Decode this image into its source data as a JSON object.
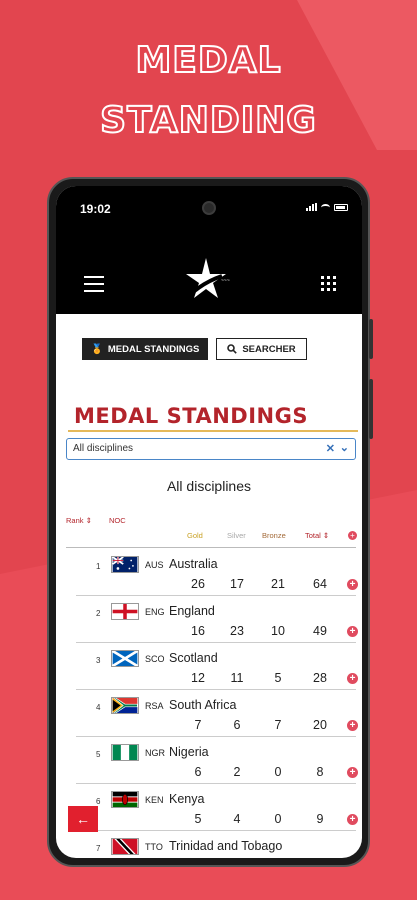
{
  "promo": {
    "line1": "MEDAL",
    "line2": "STANDING"
  },
  "status_bar": {
    "time": "19:02"
  },
  "nav": {
    "menu_icon": "hamburger-icon",
    "apps_icon": "grid-icon",
    "logo_icon": "star-logo"
  },
  "buttons": {
    "medal_standings": "MEDAL STANDINGS",
    "searcher": "SEARCHER"
  },
  "page": {
    "title": "MEDAL STANDINGS",
    "discipline_select_value": "All disciplines",
    "discipline_heading": "All disciplines"
  },
  "table": {
    "headers": {
      "rank": "Rank ⇕",
      "noc": "NOC",
      "gold": "Gold",
      "silver": "Silver",
      "bronze": "Bronze",
      "total": "Total ⇕"
    },
    "rows": [
      {
        "rank": "1",
        "code": "AUS",
        "country": "Australia",
        "gold": "26",
        "silver": "17",
        "bronze": "21",
        "total": "64"
      },
      {
        "rank": "2",
        "code": "ENG",
        "country": "England",
        "gold": "16",
        "silver": "23",
        "bronze": "10",
        "total": "49"
      },
      {
        "rank": "3",
        "code": "SCO",
        "country": "Scotland",
        "gold": "12",
        "silver": "11",
        "bronze": "5",
        "total": "28"
      },
      {
        "rank": "4",
        "code": "RSA",
        "country": "South Africa",
        "gold": "7",
        "silver": "6",
        "bronze": "7",
        "total": "20"
      },
      {
        "rank": "5",
        "code": "NGR",
        "country": "Nigeria",
        "gold": "6",
        "silver": "2",
        "bronze": "0",
        "total": "8"
      },
      {
        "rank": "6",
        "code": "KEN",
        "country": "Kenya",
        "gold": "5",
        "silver": "4",
        "bronze": "0",
        "total": "9"
      },
      {
        "rank": "7",
        "code": "TTO",
        "country": "Trinidad and Tobago"
      }
    ]
  },
  "colors": {
    "background": "#e2454f",
    "title_red": "#b3242b",
    "accent_plus": "#e04b5f"
  }
}
